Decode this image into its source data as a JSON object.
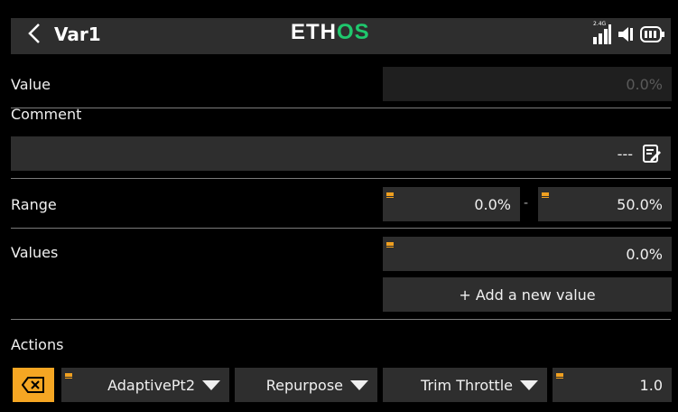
{
  "header": {
    "title": "Var1",
    "logo_part1": "ETH",
    "logo_part2": "OS",
    "signal_label": "2.4G"
  },
  "value_row": {
    "label": "Value",
    "value": "0.0%"
  },
  "comment_row": {
    "label": "Comment",
    "value": "---"
  },
  "range_row": {
    "label": "Range",
    "min": "0.0%",
    "separator": "-",
    "max": "50.0%"
  },
  "values_row": {
    "label": "Values",
    "value": "0.0%",
    "add_button": "+ Add a new value"
  },
  "actions_row": {
    "label": "Actions",
    "source": "AdaptivePt2",
    "mode": "Repurpose",
    "target": "Trim Throttle",
    "amount": "1.0"
  },
  "colors": {
    "background": "#000000",
    "field": "#2e2e2e",
    "accent_orange": "#f5a623",
    "brand_green": "#1fc86d"
  }
}
